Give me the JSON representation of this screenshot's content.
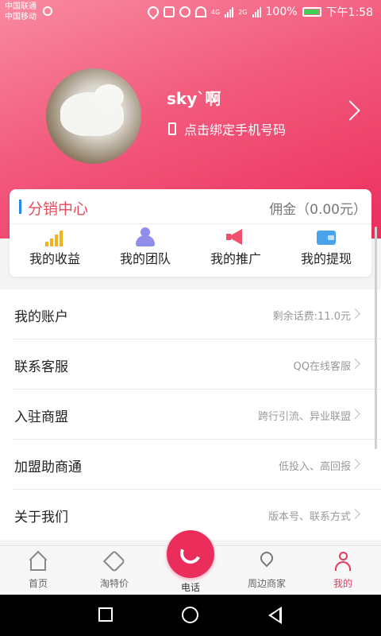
{
  "status_bar": {
    "carrier1": "中国联通",
    "carrier2": "中国移动",
    "net1": "4G",
    "net2": "2G",
    "battery": "100%",
    "time": "下午1:58"
  },
  "profile": {
    "username": "sky`啊",
    "bind_phone": "点击绑定手机号码"
  },
  "distribution": {
    "title": "分销中心",
    "commission": "佣金（0.00元）",
    "items": [
      {
        "label": "我的收益",
        "icon": "income-chart-icon"
      },
      {
        "label": "我的团队",
        "icon": "team-icon"
      },
      {
        "label": "我的推广",
        "icon": "megaphone-icon"
      },
      {
        "label": "我的提现",
        "icon": "wallet-icon"
      }
    ]
  },
  "menu": [
    {
      "title": "我的账户",
      "sub": "剩余话费:11.0元"
    },
    {
      "title": "联系客服",
      "sub": "QQ在线客服"
    },
    {
      "title": "入驻商盟",
      "sub": "跨行引流、异业联盟"
    },
    {
      "title": "加盟助商通",
      "sub": "低投入、高回报"
    },
    {
      "title": "关于我们",
      "sub": "版本号、联系方式"
    }
  ],
  "tabbar": {
    "tabs": [
      {
        "label": "首页",
        "icon": "home-icon"
      },
      {
        "label": "淘特价",
        "icon": "tag-icon"
      },
      {
        "label": "电话",
        "icon": "phone-call-icon"
      },
      {
        "label": "周边商家",
        "icon": "location-pin-icon"
      },
      {
        "label": "我的",
        "icon": "person-icon",
        "active": true
      }
    ]
  },
  "colors": {
    "header_start": "#f98aa0",
    "header_end": "#ec2e5d",
    "accent": "#e8395d",
    "title_red": "#e84b5b"
  }
}
